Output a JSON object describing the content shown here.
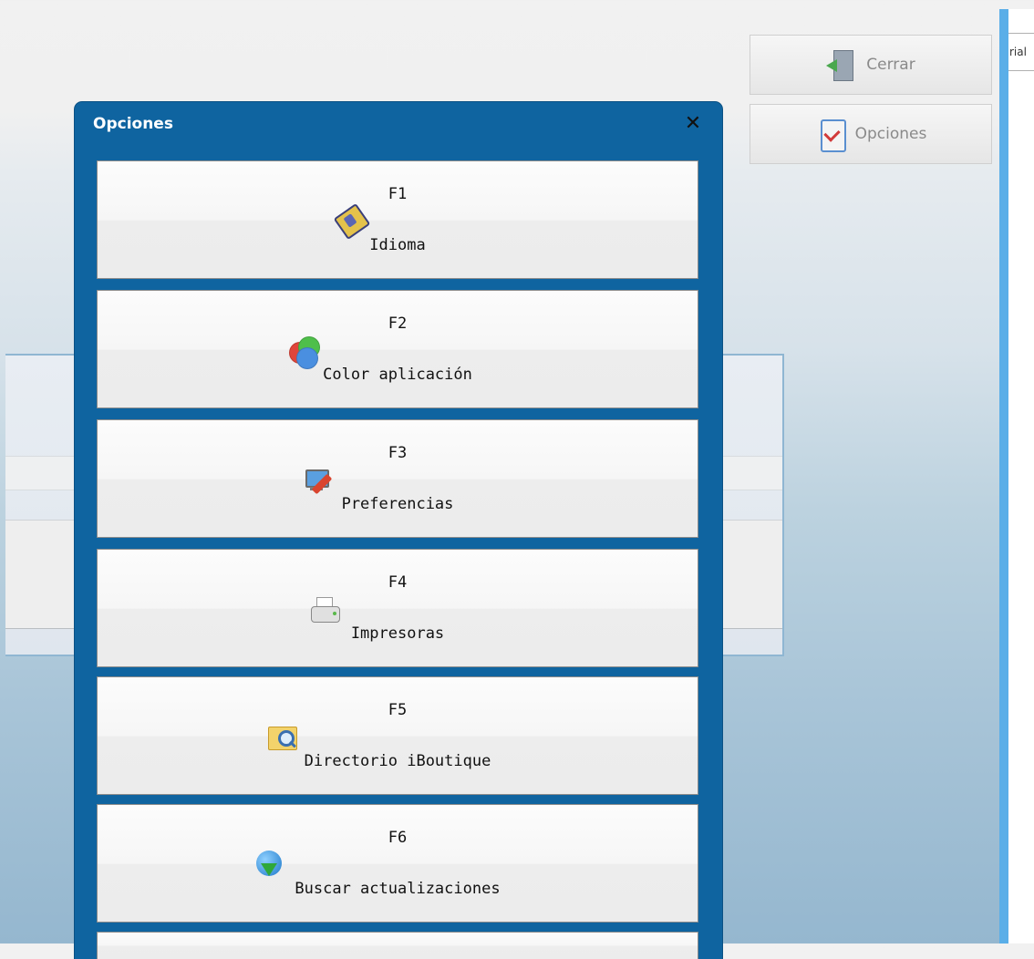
{
  "right_field": {
    "text": "rial"
  },
  "toolbar": {
    "close_label": "Cerrar",
    "close_icon": "exit-door-icon",
    "options_label": "Opciones",
    "options_icon": "checklist-icon"
  },
  "dialog": {
    "title": "Opciones",
    "close_glyph": "✕",
    "options": [
      {
        "key": "F1",
        "label": "Idioma",
        "icon": "language-book-icon"
      },
      {
        "key": "F2",
        "label": "Color aplicación",
        "icon": "color-circles-icon"
      },
      {
        "key": "F3",
        "label": "Preferencias",
        "icon": "computer-edit-icon"
      },
      {
        "key": "F4",
        "label": "Impresoras",
        "icon": "printer-icon"
      },
      {
        "key": "F5",
        "label": "Directorio iBoutique",
        "icon": "folder-search-icon"
      },
      {
        "key": "F6",
        "label": "Buscar actualizaciones",
        "icon": "globe-download-icon"
      }
    ]
  }
}
